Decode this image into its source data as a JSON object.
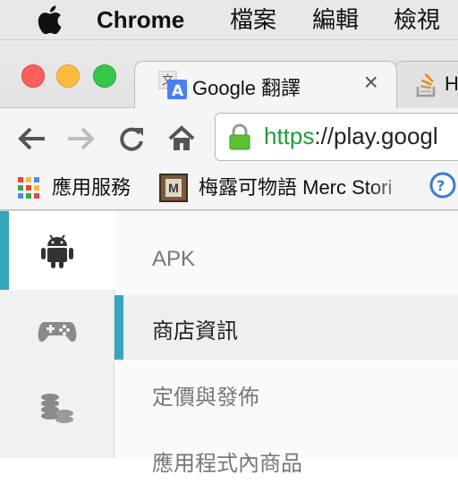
{
  "menubar": {
    "app_name": "Chrome",
    "menus": [
      "檔案",
      "編輯",
      "檢視"
    ]
  },
  "tabs": [
    {
      "title": "Google 翻譯",
      "close": "×",
      "icon": "google-translate-icon",
      "active": true
    },
    {
      "title": "H",
      "icon": "stackoverflow-icon",
      "active": false
    }
  ],
  "toolbar": {
    "url_scheme": "https",
    "url_rest": "://play.googl"
  },
  "bookmarks": [
    {
      "label": "應用服務",
      "icon": "apps-grid-icon"
    },
    {
      "label": "梅露可物語 Merc Stori",
      "icon": "merc-storia-icon"
    }
  ],
  "sidebar": {
    "items": [
      {
        "icon": "android-icon",
        "active": true
      },
      {
        "icon": "gamepad-icon",
        "active": false
      },
      {
        "icon": "coins-icon",
        "active": false
      }
    ]
  },
  "content": {
    "items": [
      {
        "label": "APK",
        "selected": false
      },
      {
        "label": "商店資訊",
        "selected": true
      },
      {
        "label": "定價與發佈",
        "selected": false
      },
      {
        "label": "應用程式內商品",
        "selected": false
      }
    ]
  },
  "colors": {
    "accent": "#36a6bd",
    "url_scheme_green": "#1d9c3b"
  }
}
